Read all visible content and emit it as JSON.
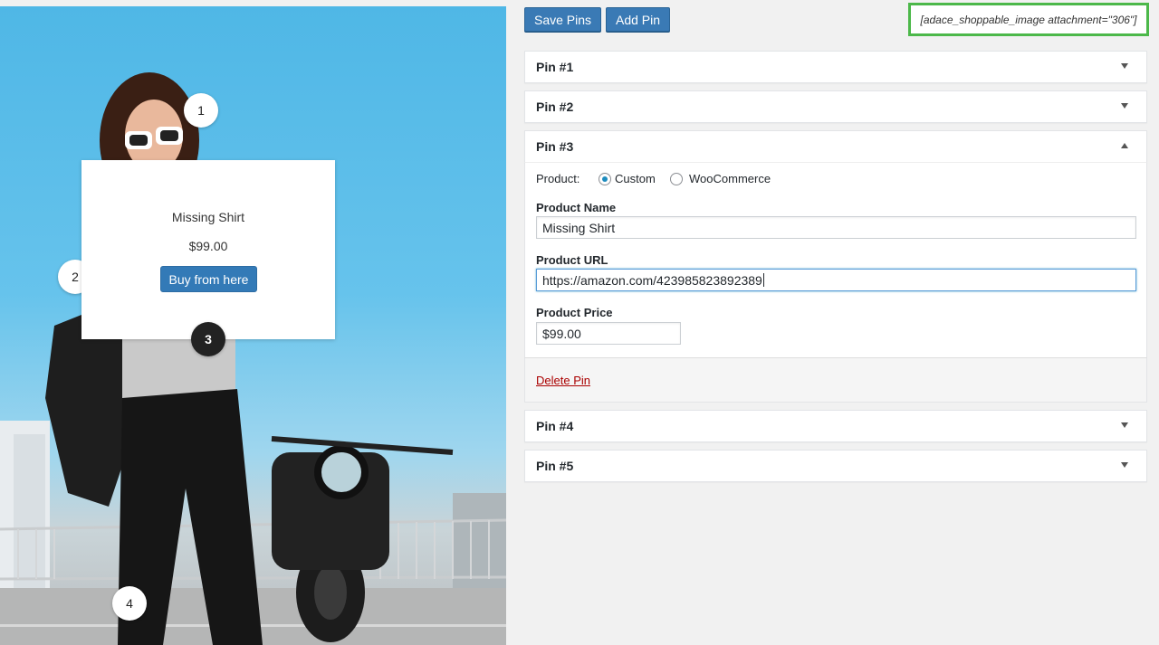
{
  "image_panel": {
    "markers": [
      {
        "label": "1"
      },
      {
        "label": "2"
      },
      {
        "label": "3"
      },
      {
        "label": "4"
      }
    ],
    "popover": {
      "product_name": "Missing Shirt",
      "price": "$99.00",
      "buy_label": "Buy from here"
    }
  },
  "toolbar": {
    "save_label": "Save Pins",
    "add_label": "Add Pin",
    "shortcode": "[adace_shoppable_image attachment=\"306\"]"
  },
  "pins": [
    {
      "title": "Pin #1",
      "expanded": false
    },
    {
      "title": "Pin #2",
      "expanded": false
    },
    {
      "title": "Pin #3",
      "expanded": true
    },
    {
      "title": "Pin #4",
      "expanded": false
    },
    {
      "title": "Pin #5",
      "expanded": false
    }
  ],
  "pin_editor": {
    "product_label": "Product:",
    "product_type_options": [
      "Custom",
      "WooCommerce"
    ],
    "product_type_selected": "Custom",
    "name_label": "Product Name",
    "name_value": "Missing Shirt",
    "url_label": "Product URL",
    "url_value": "https://amazon.com/423985823892389",
    "price_label": "Product Price",
    "price_value": "$99.00",
    "delete_label": "Delete Pin"
  },
  "colors": {
    "primary_button": "#3a7ab5",
    "shortcode_border": "#4cb84a",
    "delete_link": "#aa0000",
    "radio_accent": "#1e8cbe"
  }
}
